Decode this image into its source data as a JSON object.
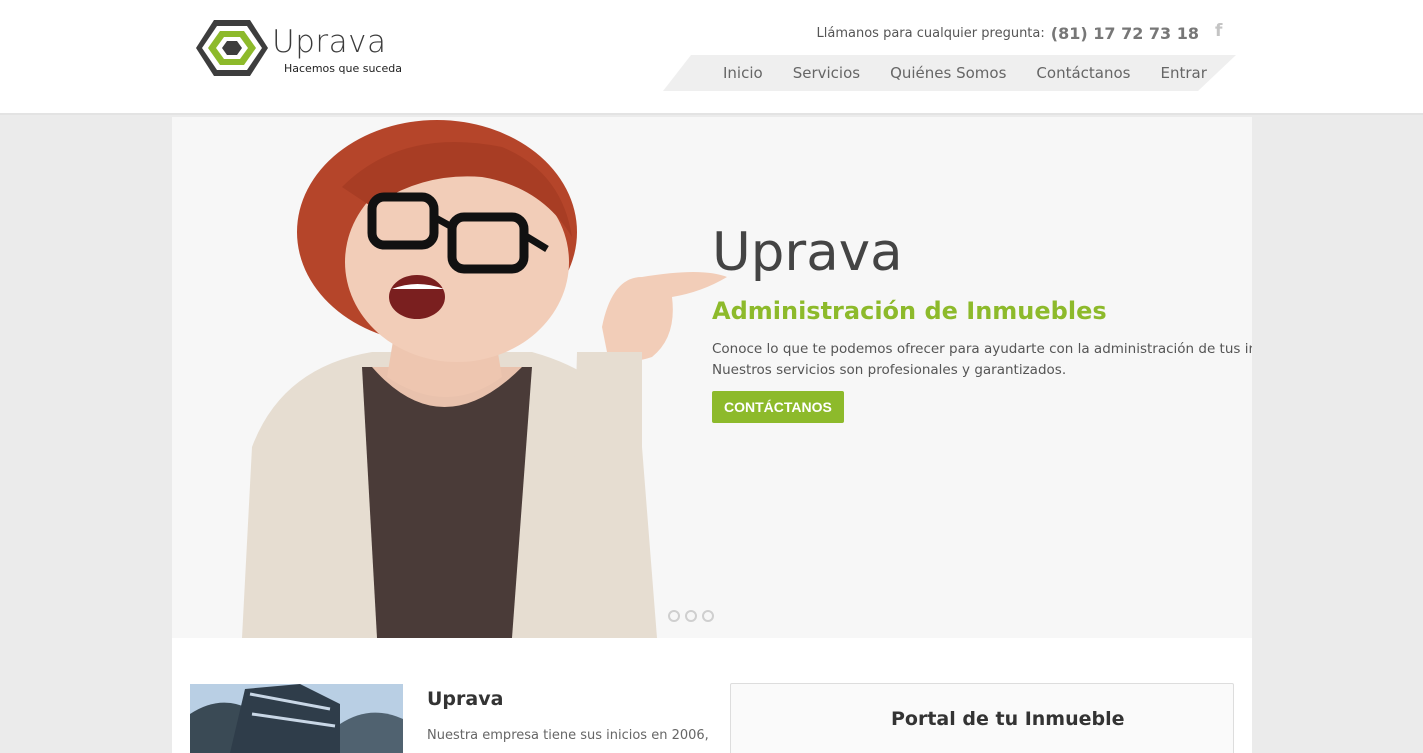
{
  "header": {
    "logo": {
      "name": "Uprava",
      "tagline": "Hacemos que suceda"
    },
    "call_label": "Llámanos para cualquier pregunta:",
    "phone": "(81) 17 72 73 18",
    "social_icon": "facebook-icon",
    "nav": [
      {
        "label": "Inicio"
      },
      {
        "label": "Servicios"
      },
      {
        "label": "Quiénes Somos"
      },
      {
        "label": "Contáctanos"
      },
      {
        "label": "Entrar"
      }
    ]
  },
  "hero": {
    "title": "Uprava",
    "subtitle": "Administración de Inmuebles",
    "description_line1": "Conoce lo que te podemos ofrecer para ayudarte con la administración de tus inmuebles.",
    "description_line2": "Nuestros servicios son profesionales y garantizados.",
    "button_label": "CONTÁCTANOS",
    "slides_count": 3,
    "active_slide": 1
  },
  "about": {
    "title": "Uprava",
    "text": "Nuestra empresa tiene sus inicios en 2006,"
  },
  "portal": {
    "title": "Portal de tu Inmueble"
  },
  "colors": {
    "accent": "#8dba2b",
    "header_bg": "#ffffff",
    "page_bg": "#ebebeb",
    "hero_bg": "#f7f7f7"
  }
}
